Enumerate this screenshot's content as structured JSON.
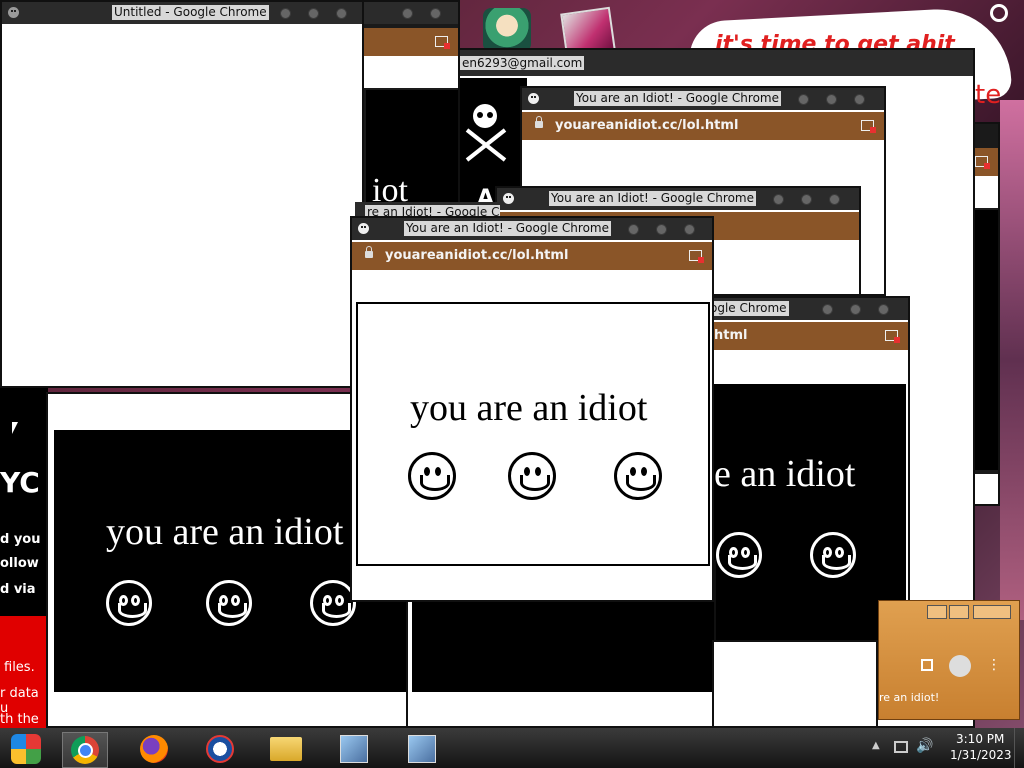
{
  "desktop": {
    "wallpaper_text": "it's time to get ahit",
    "wallpaper_text_2": "te"
  },
  "windows": {
    "untitled": {
      "title": "Untitled - Google Chrome"
    },
    "pirate": {
      "account_text": "en6293@gmail.com",
      "page_text": "iot",
      "page_text_2": "A"
    },
    "main": {
      "title": "You are an Idiot! - Google Chrome",
      "url": "youareanidiot.cc/lol.html",
      "message": "you are an idiot"
    },
    "back1": {
      "title": "You are an Idiot! - Google Chrome",
      "url": "youareanidiot.cc/lol.html"
    },
    "back2": {
      "title": "You are an Idiot! - Google Chrome"
    },
    "back3": {
      "title_fragment": "ogle Chrome",
      "url_fragment": "html",
      "message": "e an idiot"
    },
    "back4": {
      "title_fragment": "re an Idiot! - Google Chro"
    },
    "bottom_left": {
      "message": "you are an idiot"
    },
    "small": {
      "text": "re an idiot!"
    }
  },
  "left_partial": {
    "big_letter": "YC",
    "line1": "d you",
    "line2": "ollow",
    "line3": "d via",
    "red_line1": "files.",
    "red_line2": "r data u",
    "red_line3": "th the h"
  },
  "taskbar": {
    "apps": [
      "start-orb",
      "chrome",
      "firefox",
      "opera",
      "file-explorer",
      "installer",
      "installer"
    ],
    "time": "3:10 PM",
    "date": "1/31/2023"
  }
}
